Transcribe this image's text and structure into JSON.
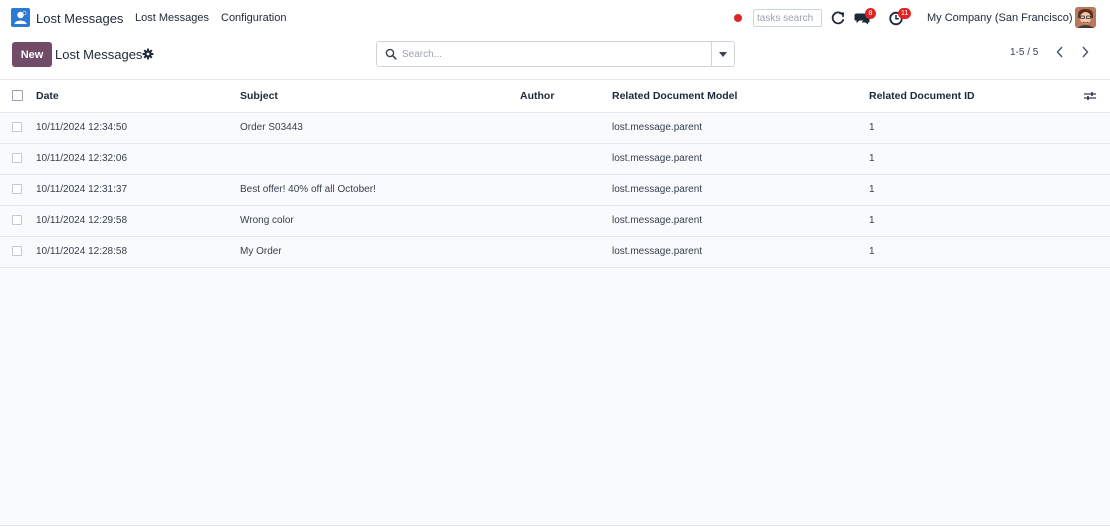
{
  "navbar": {
    "app_title": "Lost Messages",
    "menu": [
      "Lost Messages",
      "Configuration"
    ],
    "tasks_search_placeholder": "tasks search",
    "messages_badge": "8",
    "activities_badge": "11",
    "company": "My Company (San Francisco)"
  },
  "control_panel": {
    "new_label": "New",
    "title": "Lost Messages",
    "search_placeholder": "Search...",
    "pager": "1-5 / 5"
  },
  "table": {
    "columns": [
      "Date",
      "Subject",
      "Author",
      "Related Document Model",
      "Related Document ID"
    ],
    "rows": [
      {
        "date": "10/11/2024 12:34:50",
        "subject": "Order S03443",
        "author": "",
        "model": "lost.message.parent",
        "doc_id": "1"
      },
      {
        "date": "10/11/2024 12:32:06",
        "subject": "",
        "author": "",
        "model": "lost.message.parent",
        "doc_id": "1"
      },
      {
        "date": "10/11/2024 12:31:37",
        "subject": "Best offer! 40% off all October!",
        "author": "",
        "model": "lost.message.parent",
        "doc_id": "1"
      },
      {
        "date": "10/11/2024 12:29:58",
        "subject": "Wrong color",
        "author": "",
        "model": "lost.message.parent",
        "doc_id": "1"
      },
      {
        "date": "10/11/2024 12:28:58",
        "subject": "My Order",
        "author": "",
        "model": "lost.message.parent",
        "doc_id": "1"
      }
    ]
  },
  "colors": {
    "primary": "#714b67",
    "badge": "#dc2626",
    "app_icon": "#2b7bd5"
  }
}
